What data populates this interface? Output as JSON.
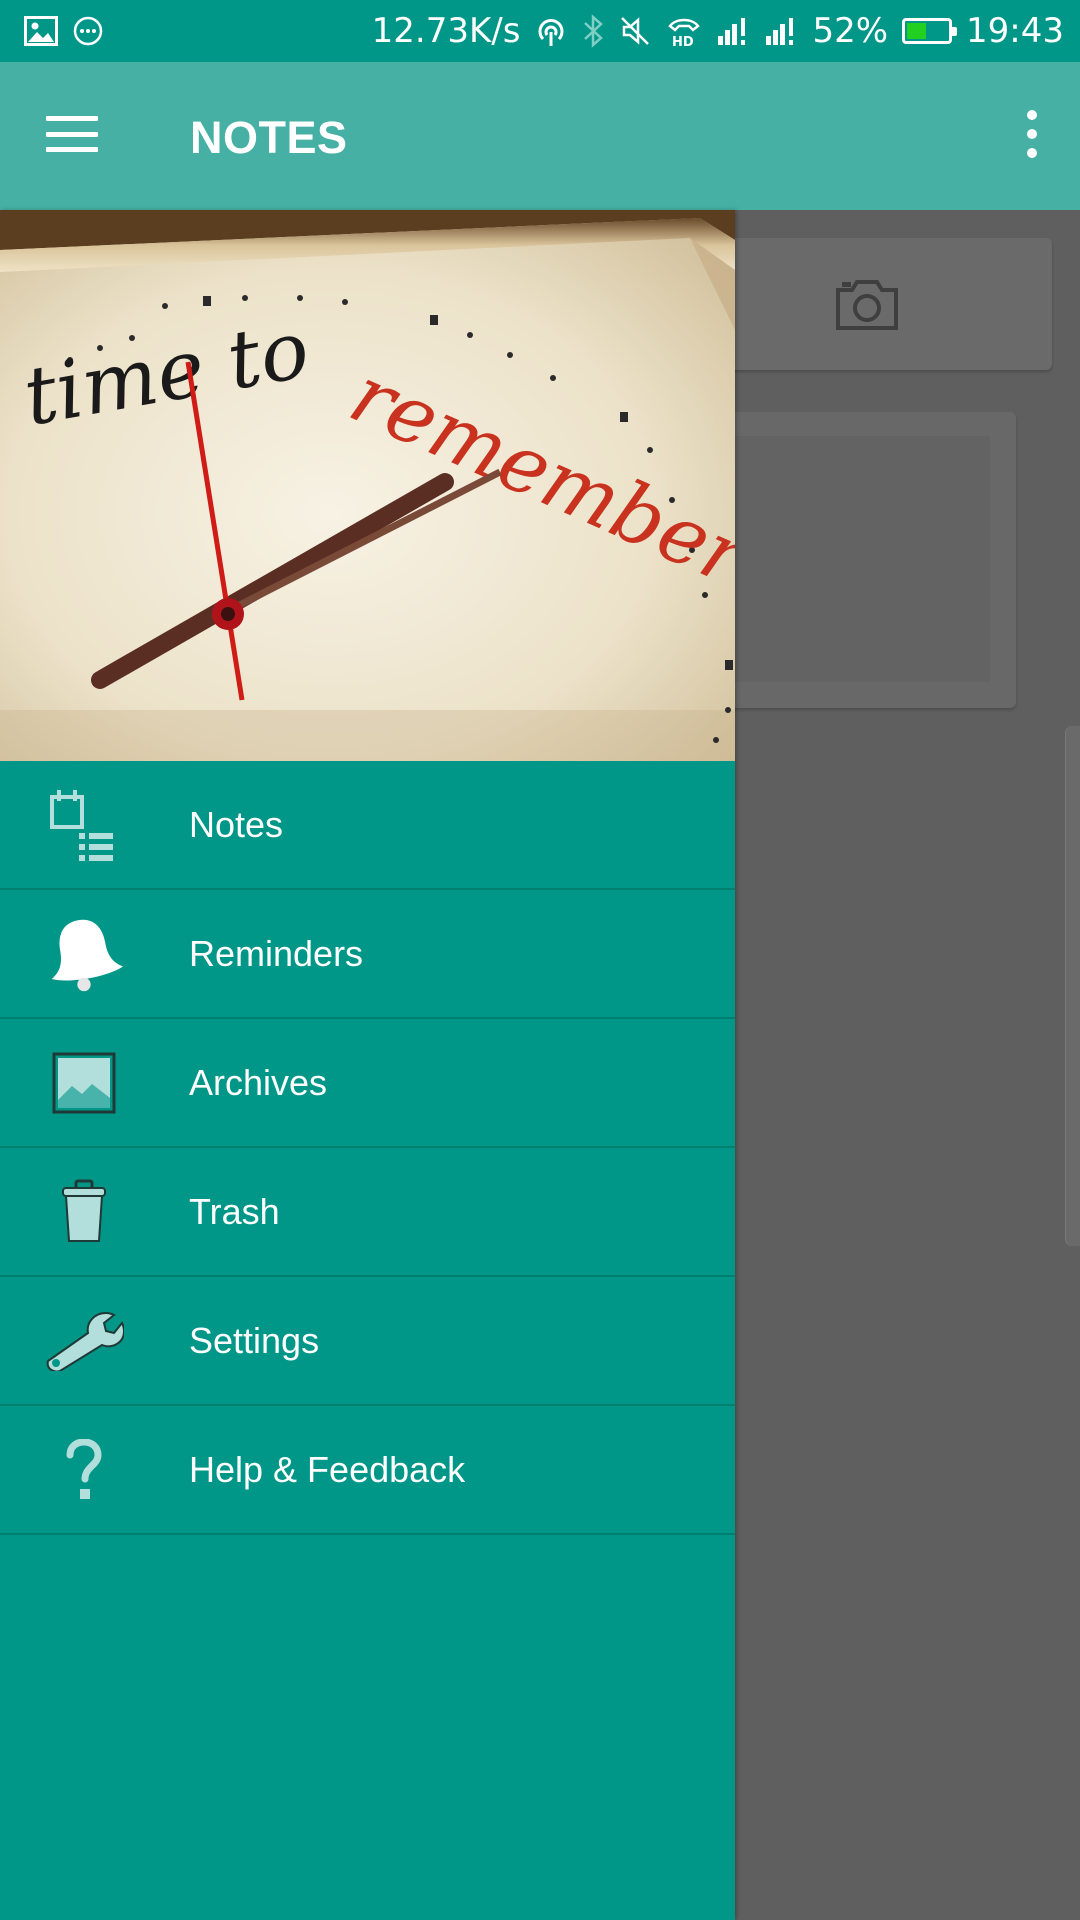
{
  "status_bar": {
    "speed": "12.73K/s",
    "battery_percent": "52%",
    "battery_level": 0.52,
    "time": "19:43",
    "icons": [
      "image-icon",
      "chat-icon",
      "hotspot-icon",
      "bluetooth-icon",
      "mute-icon",
      "hd-call-icon",
      "signal-icon",
      "signal-icon",
      "battery-icon"
    ]
  },
  "app_bar": {
    "title": "NOTES",
    "menu_icon": "hamburger-icon",
    "overflow_icon": "more-vert-icon"
  },
  "drawer": {
    "header_image": {
      "text_dark": "time to",
      "text_red": "remember",
      "description": "clock face"
    },
    "items": [
      {
        "label": "Notes",
        "icon": "notes-icon"
      },
      {
        "label": "Reminders",
        "icon": "bell-icon"
      },
      {
        "label": "Archives",
        "icon": "archive-image-icon"
      },
      {
        "label": "Trash",
        "icon": "trash-icon"
      },
      {
        "label": "Settings",
        "icon": "wrench-icon"
      },
      {
        "label": "Help & Feedback",
        "icon": "help-icon"
      }
    ]
  },
  "colors": {
    "status_bar": "#009688",
    "app_bar": "#45b0a3",
    "drawer": "#009688",
    "icon_tint": "#b2dfdb",
    "scrim": "#5f5f5f"
  }
}
